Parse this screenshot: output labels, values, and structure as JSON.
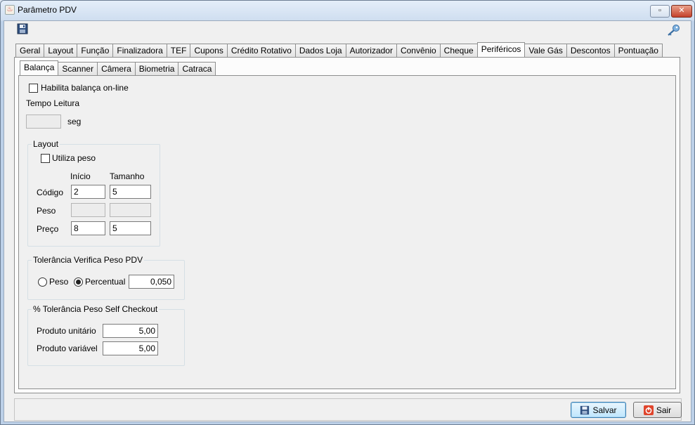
{
  "window": {
    "title": "Parâmetro PDV"
  },
  "tabs_top": [
    "Geral",
    "Layout",
    "Função",
    "Finalizadora",
    "TEF",
    "Cupons",
    "Crédito Rotativo",
    "Dados Loja",
    "Autorizador",
    "Convênio",
    "Cheque",
    "Periféricos",
    "Vale Gás",
    "Descontos",
    "Pontuação"
  ],
  "tabs_top_active": "Periféricos",
  "tabs_sub": [
    "Balança",
    "Scanner",
    "Câmera",
    "Biometria",
    "Catraca"
  ],
  "tabs_sub_active": "Balança",
  "balanca": {
    "habilita_label": "Habilita balança on-line",
    "tempo_label": "Tempo Leitura",
    "tempo_value": "",
    "tempo_unit": "seg",
    "layout": {
      "title": "Layout",
      "utiliza_peso_label": "Utiliza peso",
      "col_inicio": "Início",
      "col_tamanho": "Tamanho",
      "rows": [
        {
          "label": "Código",
          "inicio": "2",
          "tamanho": "5"
        },
        {
          "label": "Peso",
          "inicio": "",
          "tamanho": ""
        },
        {
          "label": "Preço",
          "inicio": "8",
          "tamanho": "5"
        }
      ]
    },
    "tolerancia": {
      "title": "Tolerância Verifica Peso PDV",
      "peso_label": "Peso",
      "percentual_label": "Percentual",
      "value": "0,050"
    },
    "self_checkout": {
      "title": "% Tolerância Peso Self Checkout",
      "unitario_label": "Produto unitário",
      "unitario_value": "5,00",
      "variavel_label": "Produto variável",
      "variavel_value": "5,00"
    }
  },
  "buttons": {
    "salvar": "Salvar",
    "sair": "Sair"
  }
}
